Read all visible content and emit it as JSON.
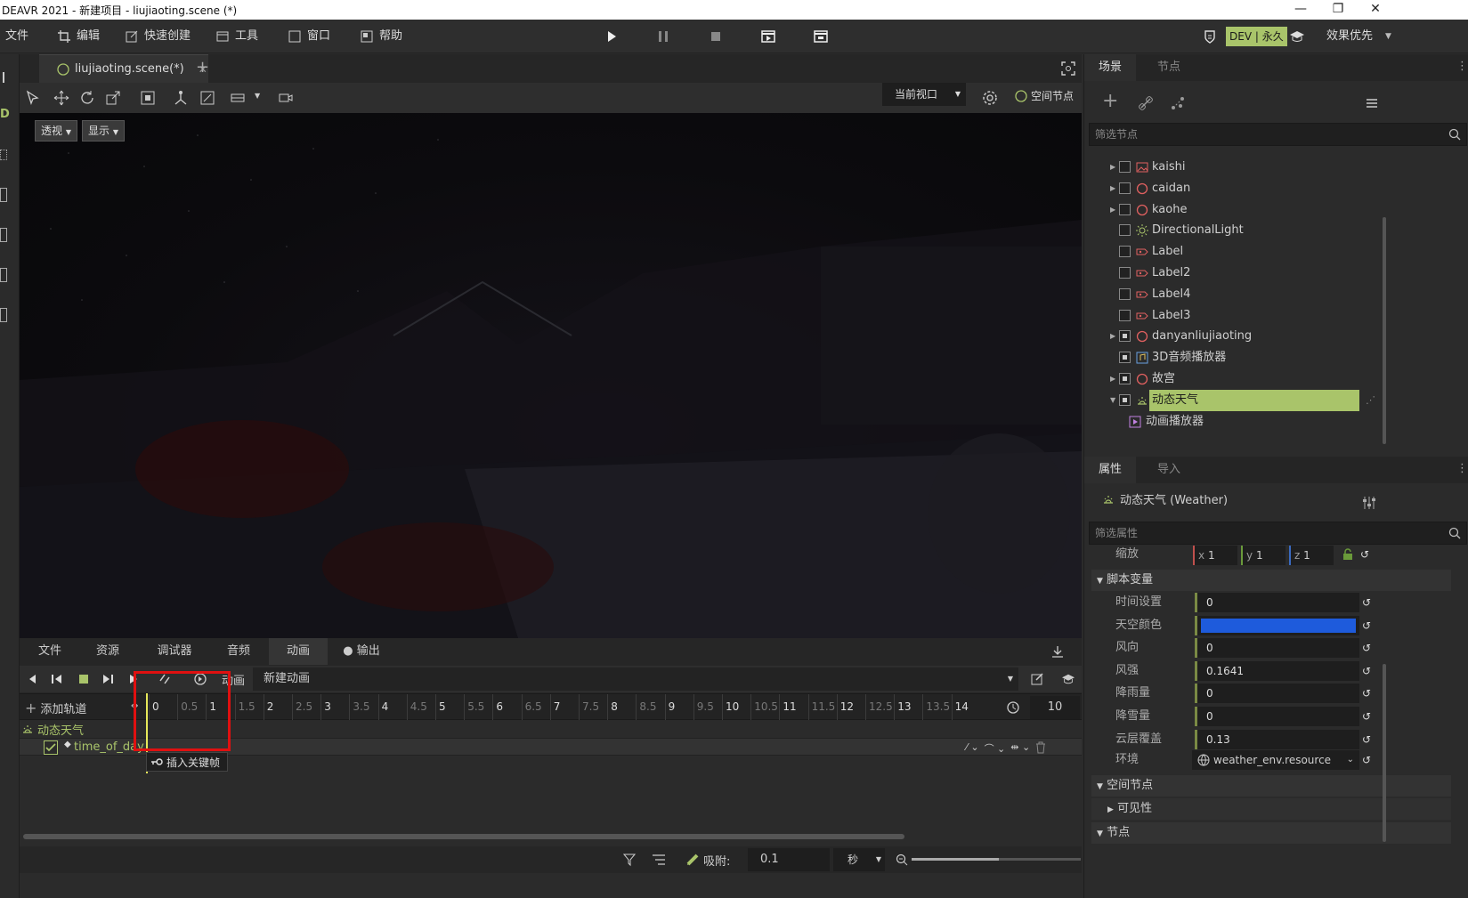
{
  "titlebar": {
    "title": "DEAVR 2021 - 新建项目 - liujiaoting.scene (*)",
    "minimize": "—",
    "maximize": "❐",
    "close": "✕"
  },
  "menubar": {
    "file": "文件",
    "edit": "编辑",
    "quick_create": "快速创建",
    "tools": "工具",
    "window": "窗口",
    "help": "帮助",
    "dev_badge": "DEV | 永久",
    "quality": "效果优先"
  },
  "document_tab": {
    "label": "liujiaoting.scene(*)",
    "close": "✕",
    "add": "+"
  },
  "viewport_toolbar": {
    "view_select": "当前视口",
    "space_node": "空间节点"
  },
  "viewport": {
    "perspective": "透视",
    "display": "显示"
  },
  "bottom_tabs": [
    "文件",
    "资源",
    "调试器",
    "音频",
    "动画",
    "● 输出"
  ],
  "anim_bar": {
    "anim_label": "动画",
    "anim_name": "新建动画"
  },
  "timeline": {
    "add_track": "添加轨道",
    "ticks": [
      "0",
      "0.5",
      "1",
      "1.5",
      "2",
      "2.5",
      "3",
      "3.5",
      "4",
      "4.5",
      "5",
      "5.5",
      "6",
      "6.5",
      "7",
      "7.5",
      "8",
      "8.5",
      "9",
      "9.5",
      "10",
      "10.5",
      "11",
      "11.5",
      "12",
      "12.5",
      "13",
      "13.5",
      "14"
    ],
    "length": "10",
    "group": "动态天气",
    "track": "time_of_day",
    "tooltip": "插入关键帧"
  },
  "statusbar": {
    "snap_label": "吸附:",
    "snap_value": "0.1",
    "unit": "秒"
  },
  "scene_panel": {
    "tabs": [
      "场景",
      "节点"
    ],
    "filter_placeholder": "筛选节点",
    "nodes": [
      {
        "name": "kaishi",
        "icon": "image-icon",
        "expand": true,
        "checked": false
      },
      {
        "name": "caidan",
        "icon": "circle-icon",
        "expand": true,
        "checked": false
      },
      {
        "name": "kaohe",
        "icon": "circle-icon",
        "expand": true,
        "checked": false
      },
      {
        "name": "DirectionalLight",
        "icon": "sun-icon",
        "expand": false,
        "checked": false
      },
      {
        "name": "Label",
        "icon": "label-icon",
        "expand": false,
        "checked": false
      },
      {
        "name": "Label2",
        "icon": "label-icon",
        "expand": false,
        "checked": false
      },
      {
        "name": "Label4",
        "icon": "label-icon",
        "expand": false,
        "checked": false
      },
      {
        "name": "Label3",
        "icon": "label-icon",
        "expand": false,
        "checked": false
      },
      {
        "name": "danyanliujiaoting",
        "icon": "circle-icon",
        "expand": true,
        "checked": true
      },
      {
        "name": "3D音频播放器",
        "icon": "audio-icon",
        "expand": false,
        "checked": true
      },
      {
        "name": "故宫",
        "icon": "circle-icon",
        "expand": true,
        "checked": true
      },
      {
        "name": "动态天气",
        "icon": "weather-icon",
        "expand": true,
        "checked": true
      },
      {
        "name": "动画播放器",
        "icon": "animation-icon",
        "expand": false,
        "checked": false
      }
    ]
  },
  "props_panel": {
    "tabs": [
      "属性",
      "导入"
    ],
    "node_title": "动态天气 (Weather)",
    "filter_placeholder": "筛选属性",
    "scale": {
      "label": "缩放",
      "x": "1",
      "y": "1",
      "z": "1"
    },
    "section_script": "脚本变量",
    "rows": [
      {
        "label": "时间设置",
        "value": "0"
      },
      {
        "label": "天空颜色",
        "value": ""
      },
      {
        "label": "风向",
        "value": "0"
      },
      {
        "label": "风强",
        "value": "0.1641"
      },
      {
        "label": "降雨量",
        "value": "0"
      },
      {
        "label": "降雪量",
        "value": "0"
      },
      {
        "label": "云层覆盖",
        "value": "0.13"
      }
    ],
    "env": {
      "label": "环境",
      "value": "weather_env.resource"
    },
    "section_space": "空间节点",
    "sub_visibility": "可见性",
    "section_node": "节点",
    "sky_color": "#1e5bdc"
  },
  "colors": {
    "accent": "#a9c46a",
    "highlight_red": "#e01010"
  }
}
